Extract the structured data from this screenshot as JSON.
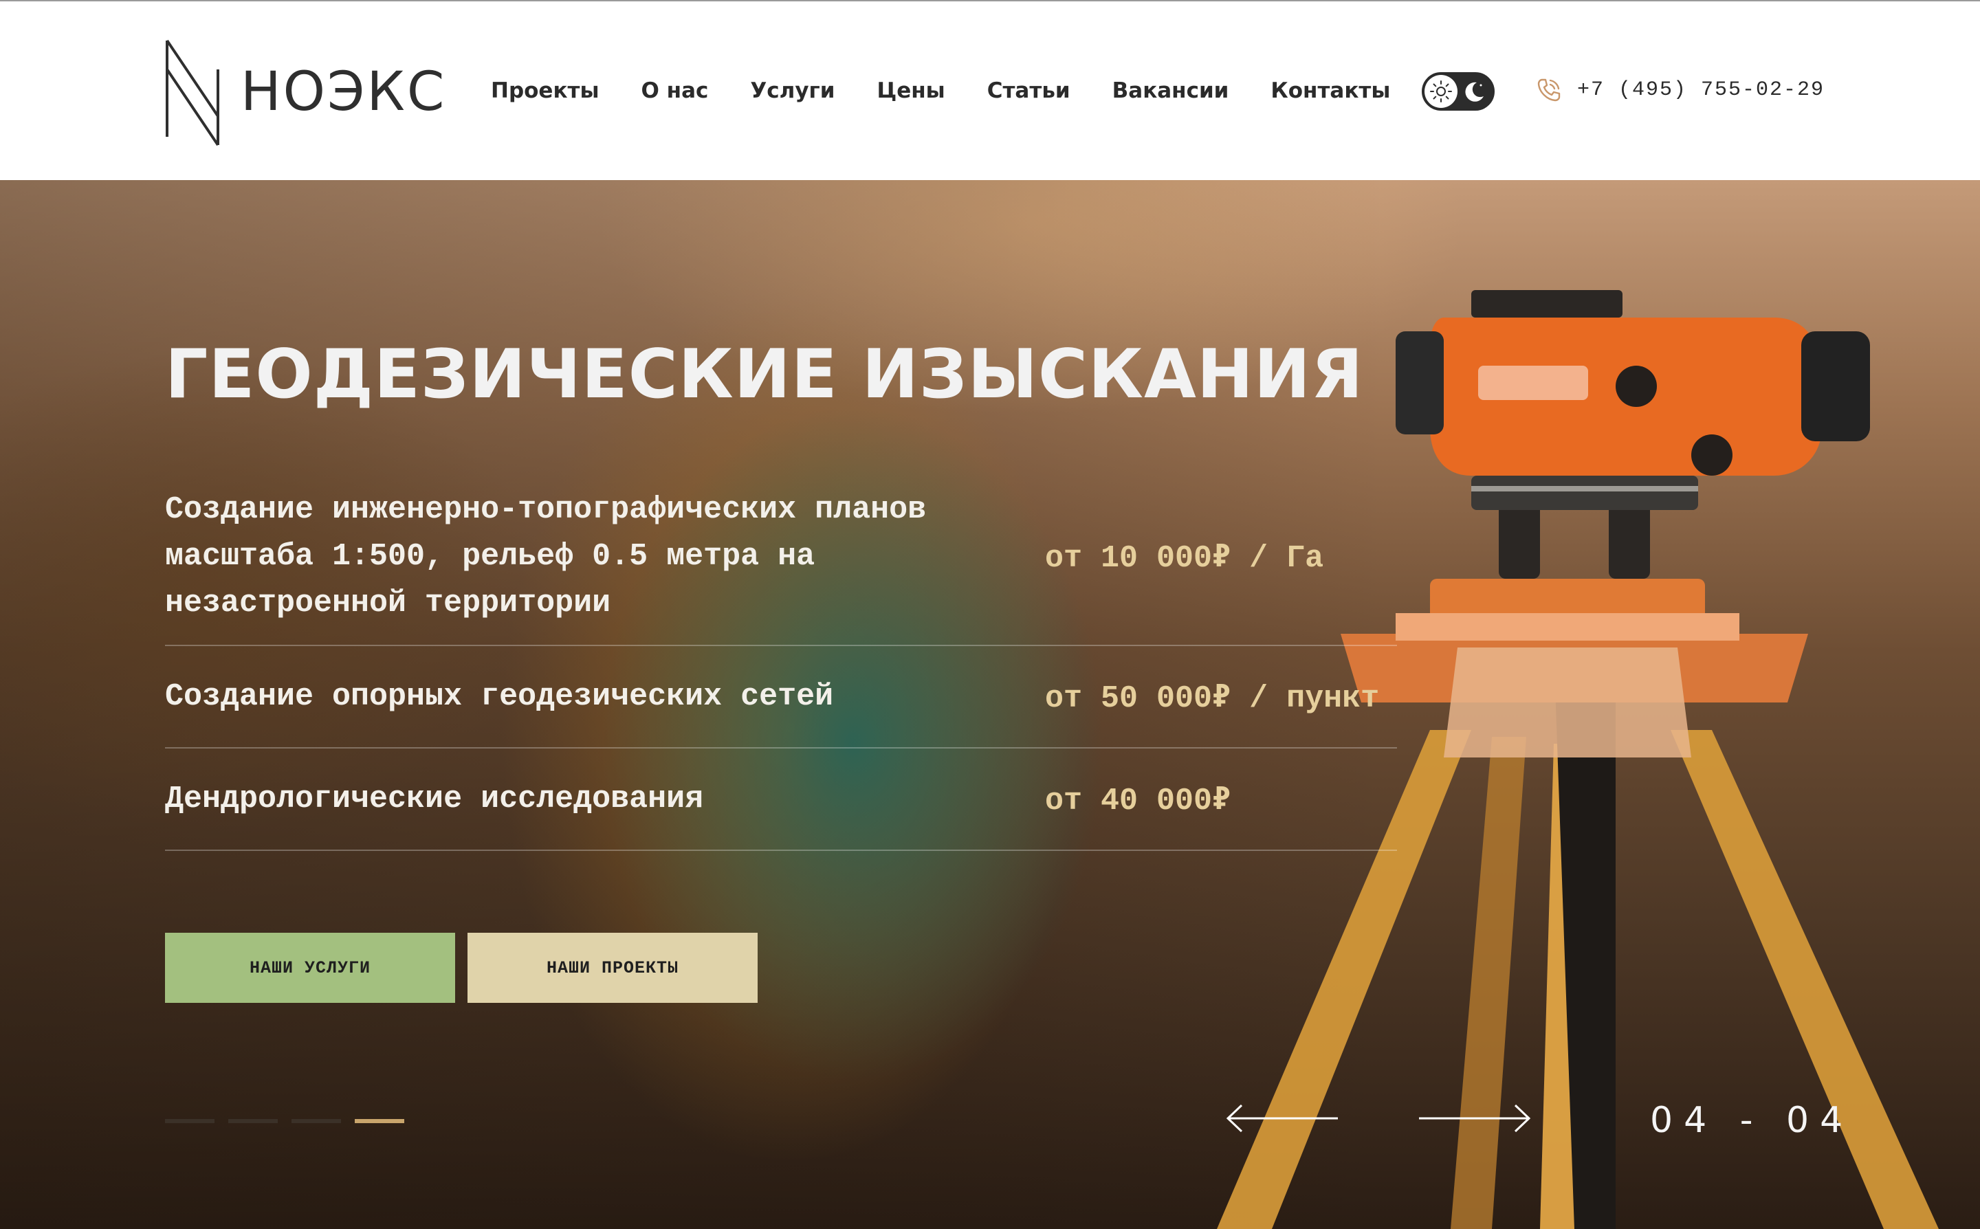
{
  "brand": {
    "name": "НОЭКС"
  },
  "nav": {
    "items": [
      {
        "label": "Проекты"
      },
      {
        "label": "О нас"
      },
      {
        "label": "Услуги"
      },
      {
        "label": "Цены"
      },
      {
        "label": "Статьи"
      },
      {
        "label": "Вакансии"
      },
      {
        "label": "Контакты"
      }
    ]
  },
  "theme_toggle": {
    "left_icon": "sun-icon",
    "right_icon": "moon-icon",
    "state": "light"
  },
  "contact": {
    "phone": "+7 (495) 755-02-29",
    "icon": "phone-icon"
  },
  "hero": {
    "title": "ГЕОДЕЗИЧЕСКИЕ ИЗЫСКАНИЯ",
    "services": [
      {
        "description": "Создание инженерно-топографических планов\nмасштаба 1:500, рельеф 0.5 метра на\nнезастроенной территории",
        "price": "от 10 000₽ / Га"
      },
      {
        "description": "Создание опорных геодезических сетей",
        "price": "от 50 000₽ / пункт"
      },
      {
        "description": "Дендрологические исследования",
        "price": "от 40 000₽"
      }
    ],
    "buttons": {
      "services": "НАШИ УСЛУГИ",
      "projects": "НАШИ ПРОЕКТЫ"
    },
    "slider": {
      "current": "04",
      "separator": "-",
      "total": "04",
      "slide_count": 4,
      "active_index": 3
    }
  },
  "colors": {
    "accent_green": "#a3c07f",
    "accent_beige": "#e0d3aa",
    "price_gold": "#e6cf9c",
    "active_dot": "#c9a56c",
    "phone_icon": "#c9976b"
  }
}
